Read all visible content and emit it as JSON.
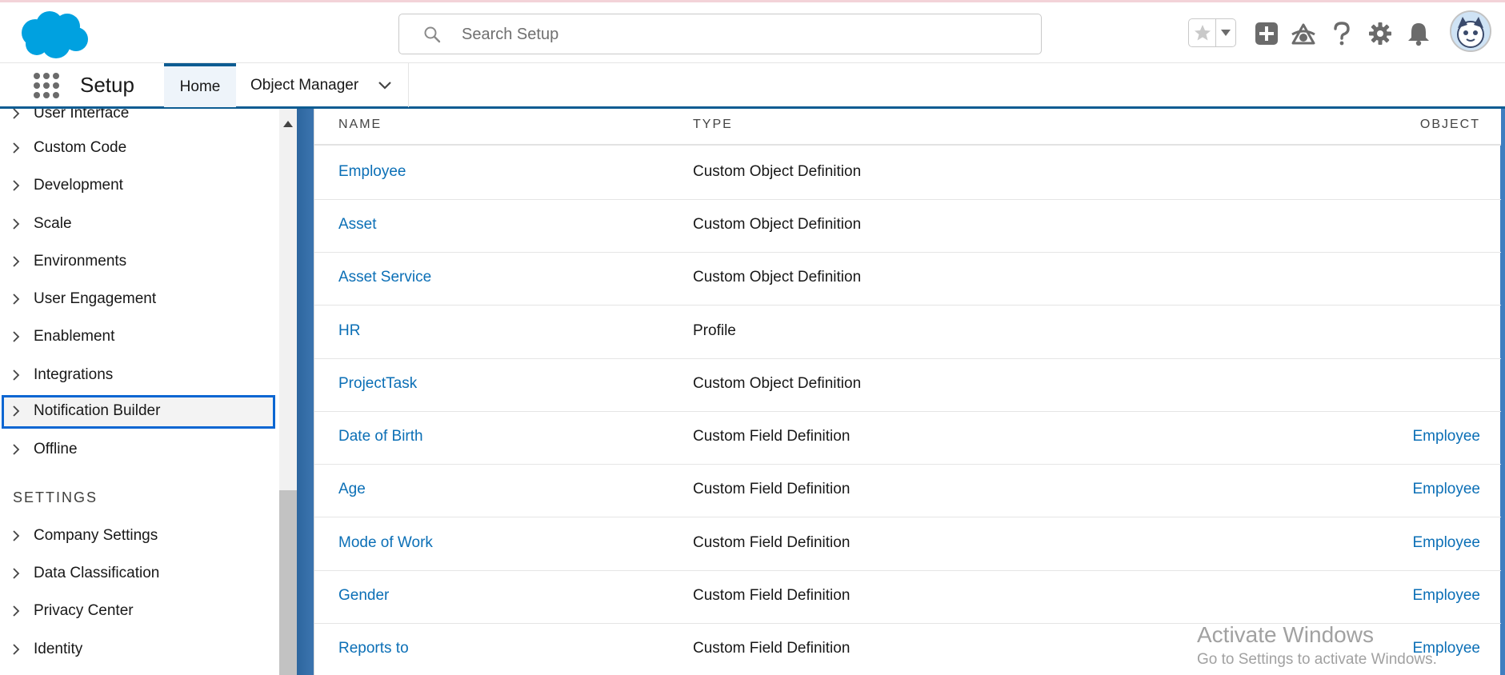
{
  "header": {
    "search_placeholder": "Search Setup",
    "brand_color": "#00a1e0",
    "icons": [
      "salesforce-logo",
      "search-icon",
      "star-icon",
      "chevron-down-icon",
      "add-icon",
      "trailhead-icon",
      "help-icon",
      "gear-icon",
      "bell-icon",
      "avatar"
    ]
  },
  "nav": {
    "app_name": "Setup",
    "tabs": [
      {
        "label": "Home",
        "active": true
      },
      {
        "label": "Object Manager",
        "active": false
      }
    ]
  },
  "sidebar": {
    "items": [
      {
        "label": "User Interface"
      },
      {
        "label": "Custom Code"
      },
      {
        "label": "Development"
      },
      {
        "label": "Scale"
      },
      {
        "label": "Environments"
      },
      {
        "label": "User Engagement"
      },
      {
        "label": "Enablement"
      },
      {
        "label": "Integrations"
      },
      {
        "label": "Notification Builder",
        "selected": true
      },
      {
        "label": "Offline"
      }
    ],
    "settings_heading": "SETTINGS",
    "settings_items": [
      {
        "label": "Company Settings"
      },
      {
        "label": "Data Classification"
      },
      {
        "label": "Privacy Center"
      },
      {
        "label": "Identity"
      }
    ]
  },
  "table": {
    "columns": [
      "NAME",
      "TYPE",
      "OBJECT"
    ],
    "rows": [
      {
        "name": "Employee",
        "type": "Custom Object Definition",
        "object": ""
      },
      {
        "name": "Asset",
        "type": "Custom Object Definition",
        "object": ""
      },
      {
        "name": "Asset Service",
        "type": "Custom Object Definition",
        "object": ""
      },
      {
        "name": "HR",
        "type": "Profile",
        "object": ""
      },
      {
        "name": "ProjectTask",
        "type": "Custom Object Definition",
        "object": ""
      },
      {
        "name": "Date of Birth",
        "type": "Custom Field Definition",
        "object": "Employee"
      },
      {
        "name": "Age",
        "type": "Custom Field Definition",
        "object": "Employee"
      },
      {
        "name": "Mode of Work",
        "type": "Custom Field Definition",
        "object": "Employee"
      },
      {
        "name": "Gender",
        "type": "Custom Field Definition",
        "object": "Employee"
      },
      {
        "name": "Reports to",
        "type": "Custom Field Definition",
        "object": "Employee"
      }
    ]
  },
  "watermark": {
    "line1": "Activate Windows",
    "line2": "Go to Settings to activate Windows."
  }
}
